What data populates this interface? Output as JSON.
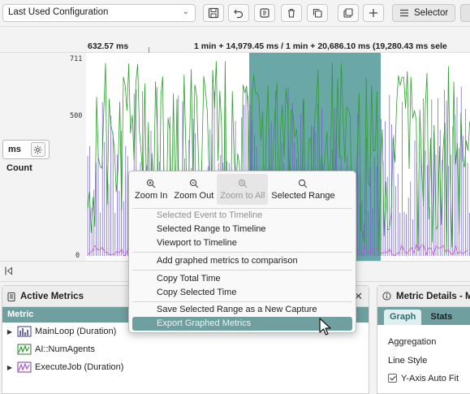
{
  "toolbar": {
    "config_value": "Last Used Configuration",
    "selector_label": "Selector",
    "icons": [
      "save-icon",
      "undo-icon",
      "load-icon",
      "delete-icon",
      "copy-icon",
      "capture-icon",
      "add-icon",
      "list-icon"
    ]
  },
  "ruler": {
    "cursor_time": "632.57 ms",
    "range_text": "1 min + 14,979.45 ms / 1 min + 20,686.10 ms (19,280.43 ms sele"
  },
  "graph": {
    "y_ticks": [
      "711",
      "500",
      "0"
    ],
    "unit": "ms",
    "count_label": "Count",
    "colors": {
      "selection": "#6aa7a7",
      "green": "#2e9e2e",
      "purple": "#6a5acd",
      "magenta": "#d14fd1"
    }
  },
  "context_menu": {
    "zoom": [
      {
        "label": "Zoom In",
        "icon": "zoom-in-icon",
        "enabled": true
      },
      {
        "label": "Zoom Out",
        "icon": "zoom-out-icon",
        "enabled": true
      },
      {
        "label": "Zoom to All",
        "icon": "zoom-all-icon",
        "enabled": false
      },
      {
        "label": "Selected Range",
        "icon": "zoom-range-icon",
        "enabled": true
      }
    ],
    "items": [
      {
        "label": "Selected Event to Timeline",
        "enabled": false
      },
      {
        "label": "Selected Range to Timeline",
        "enabled": true
      },
      {
        "label": "Viewport to Timeline",
        "enabled": true
      },
      {
        "label": "Add graphed metrics to comparison",
        "enabled": true
      },
      {
        "label": "Copy Total Time",
        "enabled": true
      },
      {
        "label": "Copy Selected Time",
        "enabled": true
      },
      {
        "label": "Save Selected Range as a New Capture",
        "enabled": true
      },
      {
        "label": "Export Graphed Metrics",
        "enabled": true,
        "hovered": true
      }
    ]
  },
  "active_metrics": {
    "title": "Active Metrics",
    "column": "Metric",
    "rows": [
      {
        "label": "MainLoop (Duration)",
        "icon": "bar-chart-icon",
        "expandable": true
      },
      {
        "label": "AI::NumAgents",
        "icon": "line-chart-green-icon",
        "expandable": false
      },
      {
        "label": "ExecuteJob (Duration)",
        "icon": "line-chart-purple-icon",
        "expandable": true
      }
    ]
  },
  "metric_details": {
    "title": "Metric Details - M",
    "tabs": [
      "Graph",
      "Stats"
    ],
    "aggregation_label": "Aggregation",
    "line_style_label": "Line Style",
    "auto_fit_label": "Y-Axis Auto Fit"
  }
}
